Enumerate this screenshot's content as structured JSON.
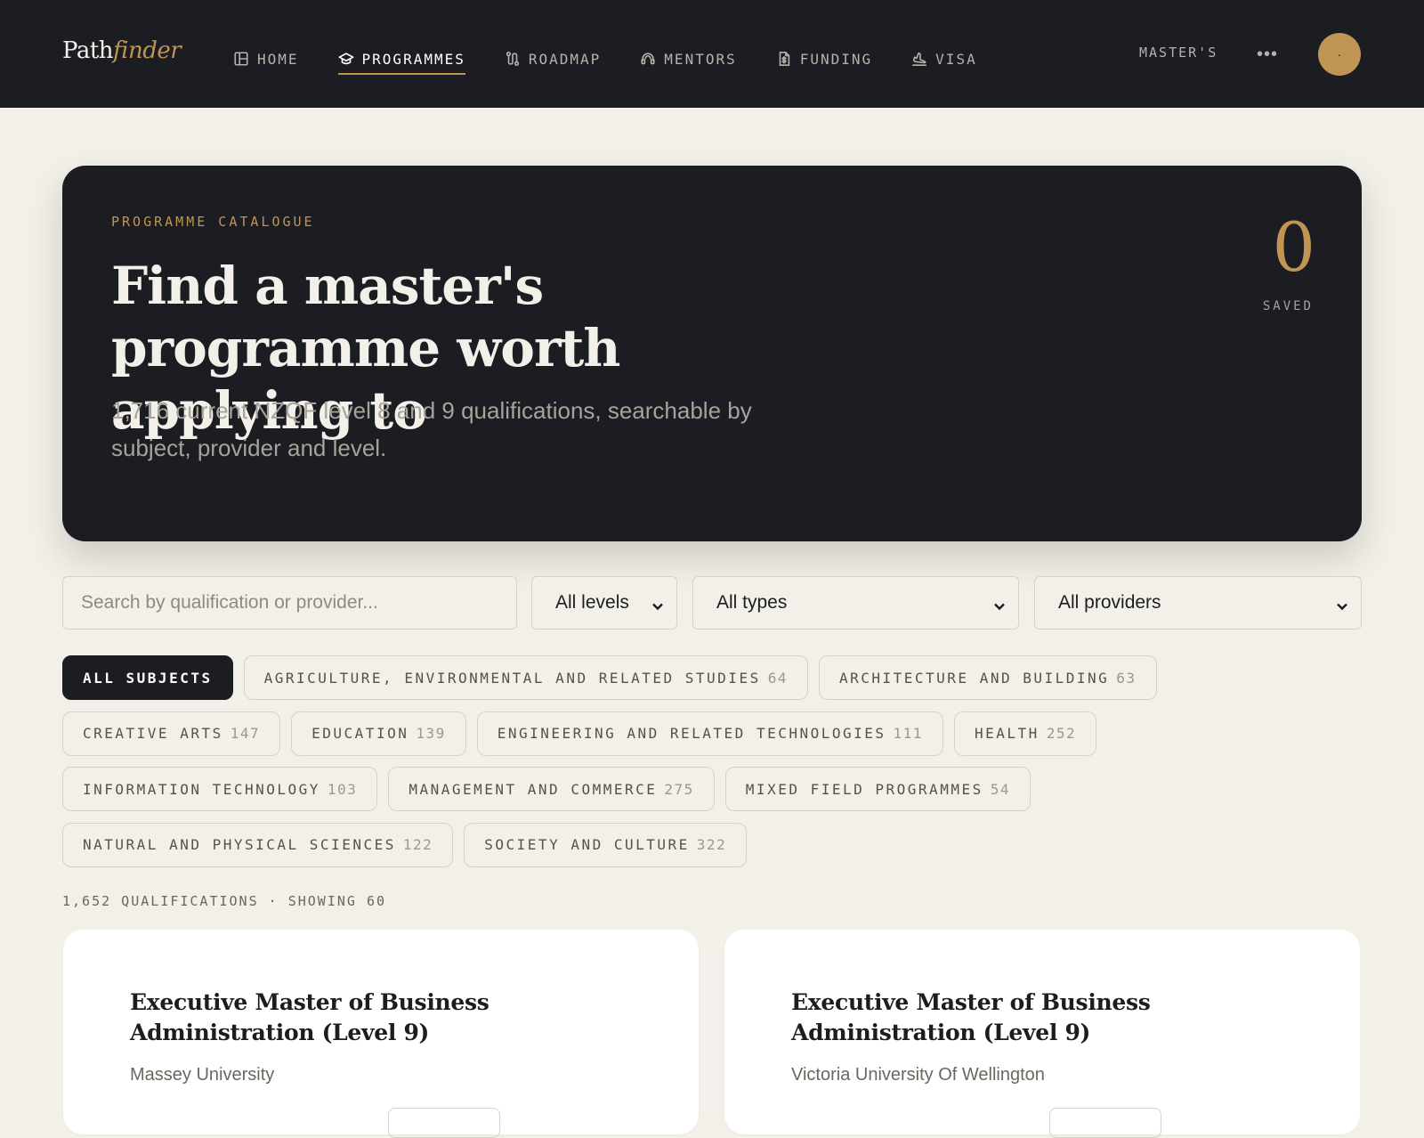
{
  "app": {
    "logo_main": "Path",
    "logo_accent": "finder"
  },
  "nav": {
    "items": [
      {
        "label": "HOME",
        "icon": "layout-icon"
      },
      {
        "label": "PROGRAMMES",
        "icon": "graduation-cap-icon",
        "active": true
      },
      {
        "label": "ROADMAP",
        "icon": "route-icon"
      },
      {
        "label": "MENTORS",
        "icon": "headset-icon"
      },
      {
        "label": "FUNDING",
        "icon": "dollar-file-icon"
      },
      {
        "label": "VISA",
        "icon": "plane-icon"
      }
    ],
    "level_tag": "MASTER'S",
    "more_label": "•••",
    "avatar_label": "·"
  },
  "hero": {
    "eyebrow": "PROGRAMME CATALOGUE",
    "title": "Find a master's programme worth applying to",
    "subtitle": "1,716 current NZQF level 8 and 9 qualifications, searchable by subject, provider and level.",
    "saved_count": "0",
    "saved_label": "SAVED"
  },
  "filters": {
    "search_placeholder": "Search by qualification or provider...",
    "level": "All levels",
    "type": "All types",
    "provider": "All providers"
  },
  "subjects": [
    {
      "label": "ALL SUBJECTS",
      "count": "",
      "active": true
    },
    {
      "label": "AGRICULTURE, ENVIRONMENTAL AND RELATED STUDIES",
      "count": "64"
    },
    {
      "label": "ARCHITECTURE AND BUILDING",
      "count": "63"
    },
    {
      "label": "CREATIVE ARTS",
      "count": "147"
    },
    {
      "label": "EDUCATION",
      "count": "139"
    },
    {
      "label": "ENGINEERING AND RELATED TECHNOLOGIES",
      "count": "111"
    },
    {
      "label": "HEALTH",
      "count": "252"
    },
    {
      "label": "INFORMATION TECHNOLOGY",
      "count": "103"
    },
    {
      "label": "MANAGEMENT AND COMMERCE",
      "count": "275"
    },
    {
      "label": "MIXED FIELD PROGRAMMES",
      "count": "54"
    },
    {
      "label": "NATURAL AND PHYSICAL SCIENCES",
      "count": "122"
    },
    {
      "label": "SOCIETY AND CULTURE",
      "count": "322"
    }
  ],
  "results": {
    "summary": "1,652 QUALIFICATIONS · SHOWING 60"
  },
  "cards": [
    {
      "title": "Executive Master of Business Administration (Level 9)",
      "provider": "Massey University"
    },
    {
      "title": "Executive Master of Business Administration (Level 9)",
      "provider": "Victoria University Of Wellington"
    }
  ],
  "colors": {
    "accent": "#c09554",
    "dark": "#1b1d22",
    "background": "#f3f0ea"
  }
}
